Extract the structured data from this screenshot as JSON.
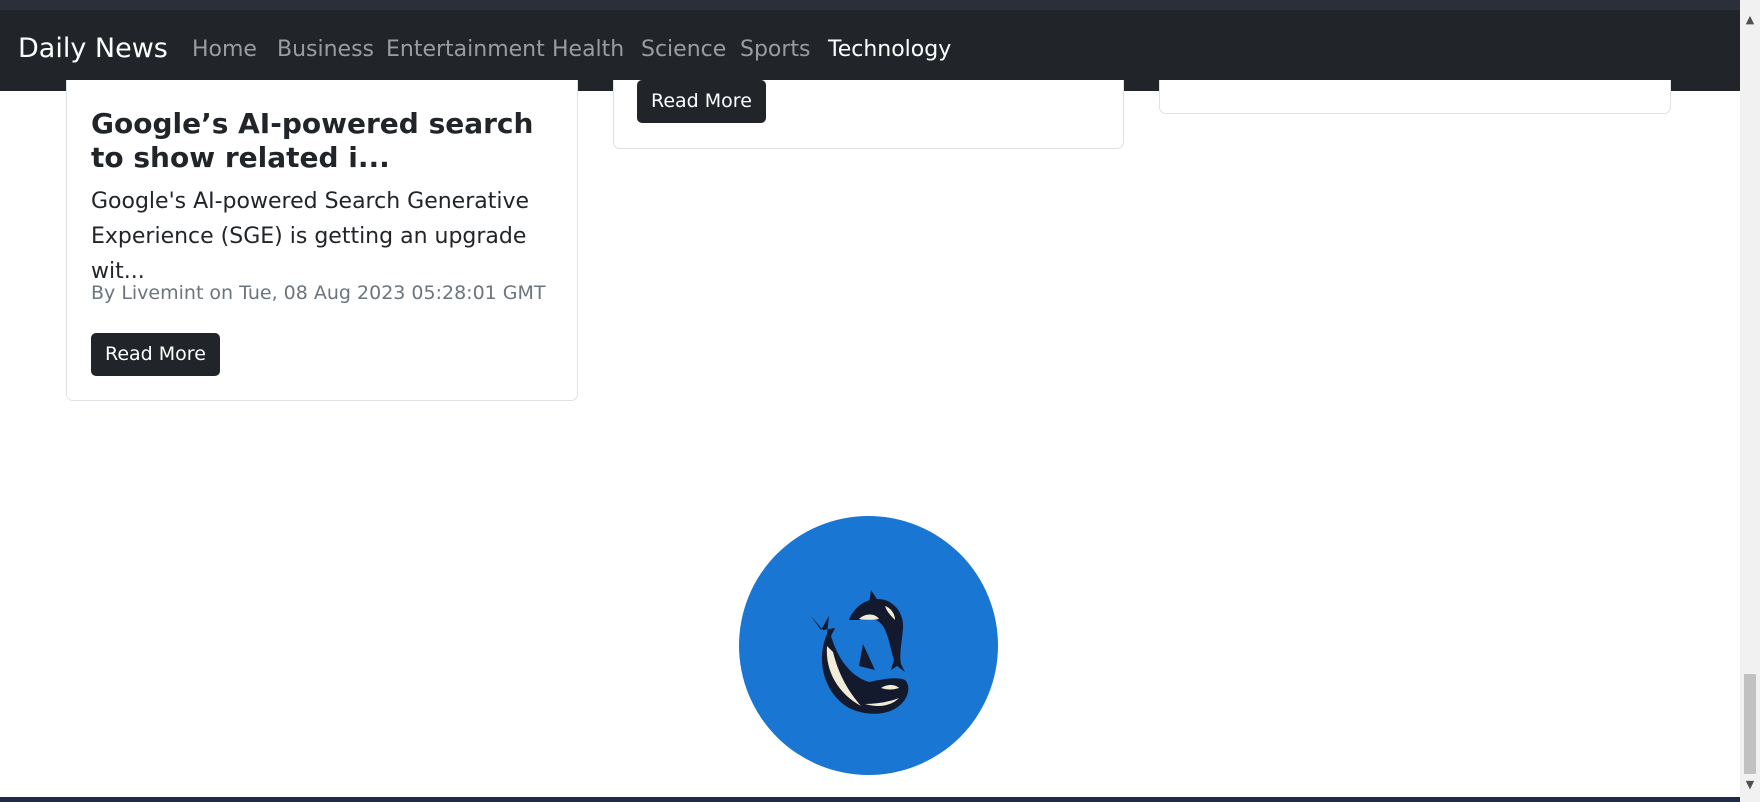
{
  "navbar": {
    "brand": "Daily News",
    "links": [
      "Home",
      "Business",
      "Entertainment",
      "Health",
      "Science",
      "Sports",
      "Technology"
    ],
    "active": "Technology"
  },
  "cards": [
    {
      "title": "Google’s AI-powered search to show related i...",
      "description": "Google's AI-powered Search Generative Experience (SGE) is getting an upgrade wit...",
      "meta": "By Livemint on Tue, 08 Aug 2023 05:28:01 GMT",
      "button": "Read More"
    },
    {
      "button": "Read More"
    }
  ],
  "footer_logo": {
    "icon": "orca-logo-icon",
    "background": "#1976d2"
  },
  "colors": {
    "navbar": "#212529",
    "nav_inactive": "#9a9da0",
    "nav_active": "#ffffff",
    "button": "#212529",
    "meta_text": "#6c757d"
  }
}
